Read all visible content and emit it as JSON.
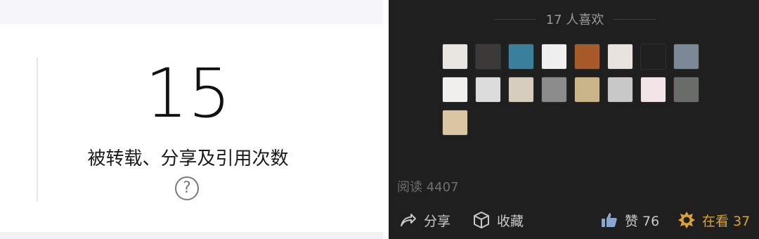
{
  "left_panel": {
    "count": "15",
    "label": "被转载、分享及引用次数",
    "help_icon": "question-circle-icon"
  },
  "right_panel": {
    "likes_header": "17 人喜欢",
    "avatars": [
      {
        "color": "#e9e6e1"
      },
      {
        "color": "#3b3a39"
      },
      {
        "color": "#3a7f9c"
      },
      {
        "color": "#f0f0f0"
      },
      {
        "color": "#a85a2a"
      },
      {
        "color": "#e9e3e0"
      },
      {
        "color": "#202020"
      },
      {
        "color": "#7a8796"
      },
      {
        "color": "#f2f0ee"
      },
      {
        "color": "#dcdcdc"
      },
      {
        "color": "#d6cdbf"
      },
      {
        "color": "#8c8c8c"
      },
      {
        "color": "#c9b48a"
      },
      {
        "color": "#c8c8c8"
      },
      {
        "color": "#f3e4e6"
      },
      {
        "color": "#6a6e68"
      },
      {
        "color": "#d9c5a2"
      }
    ],
    "read_count": "阅读 4407",
    "actions": {
      "share": "分享",
      "favorite": "收藏",
      "like": "赞 76",
      "looking": "在看 37"
    },
    "colors": {
      "background": "#1f1f1f",
      "looking_accent": "#d9a233"
    }
  }
}
